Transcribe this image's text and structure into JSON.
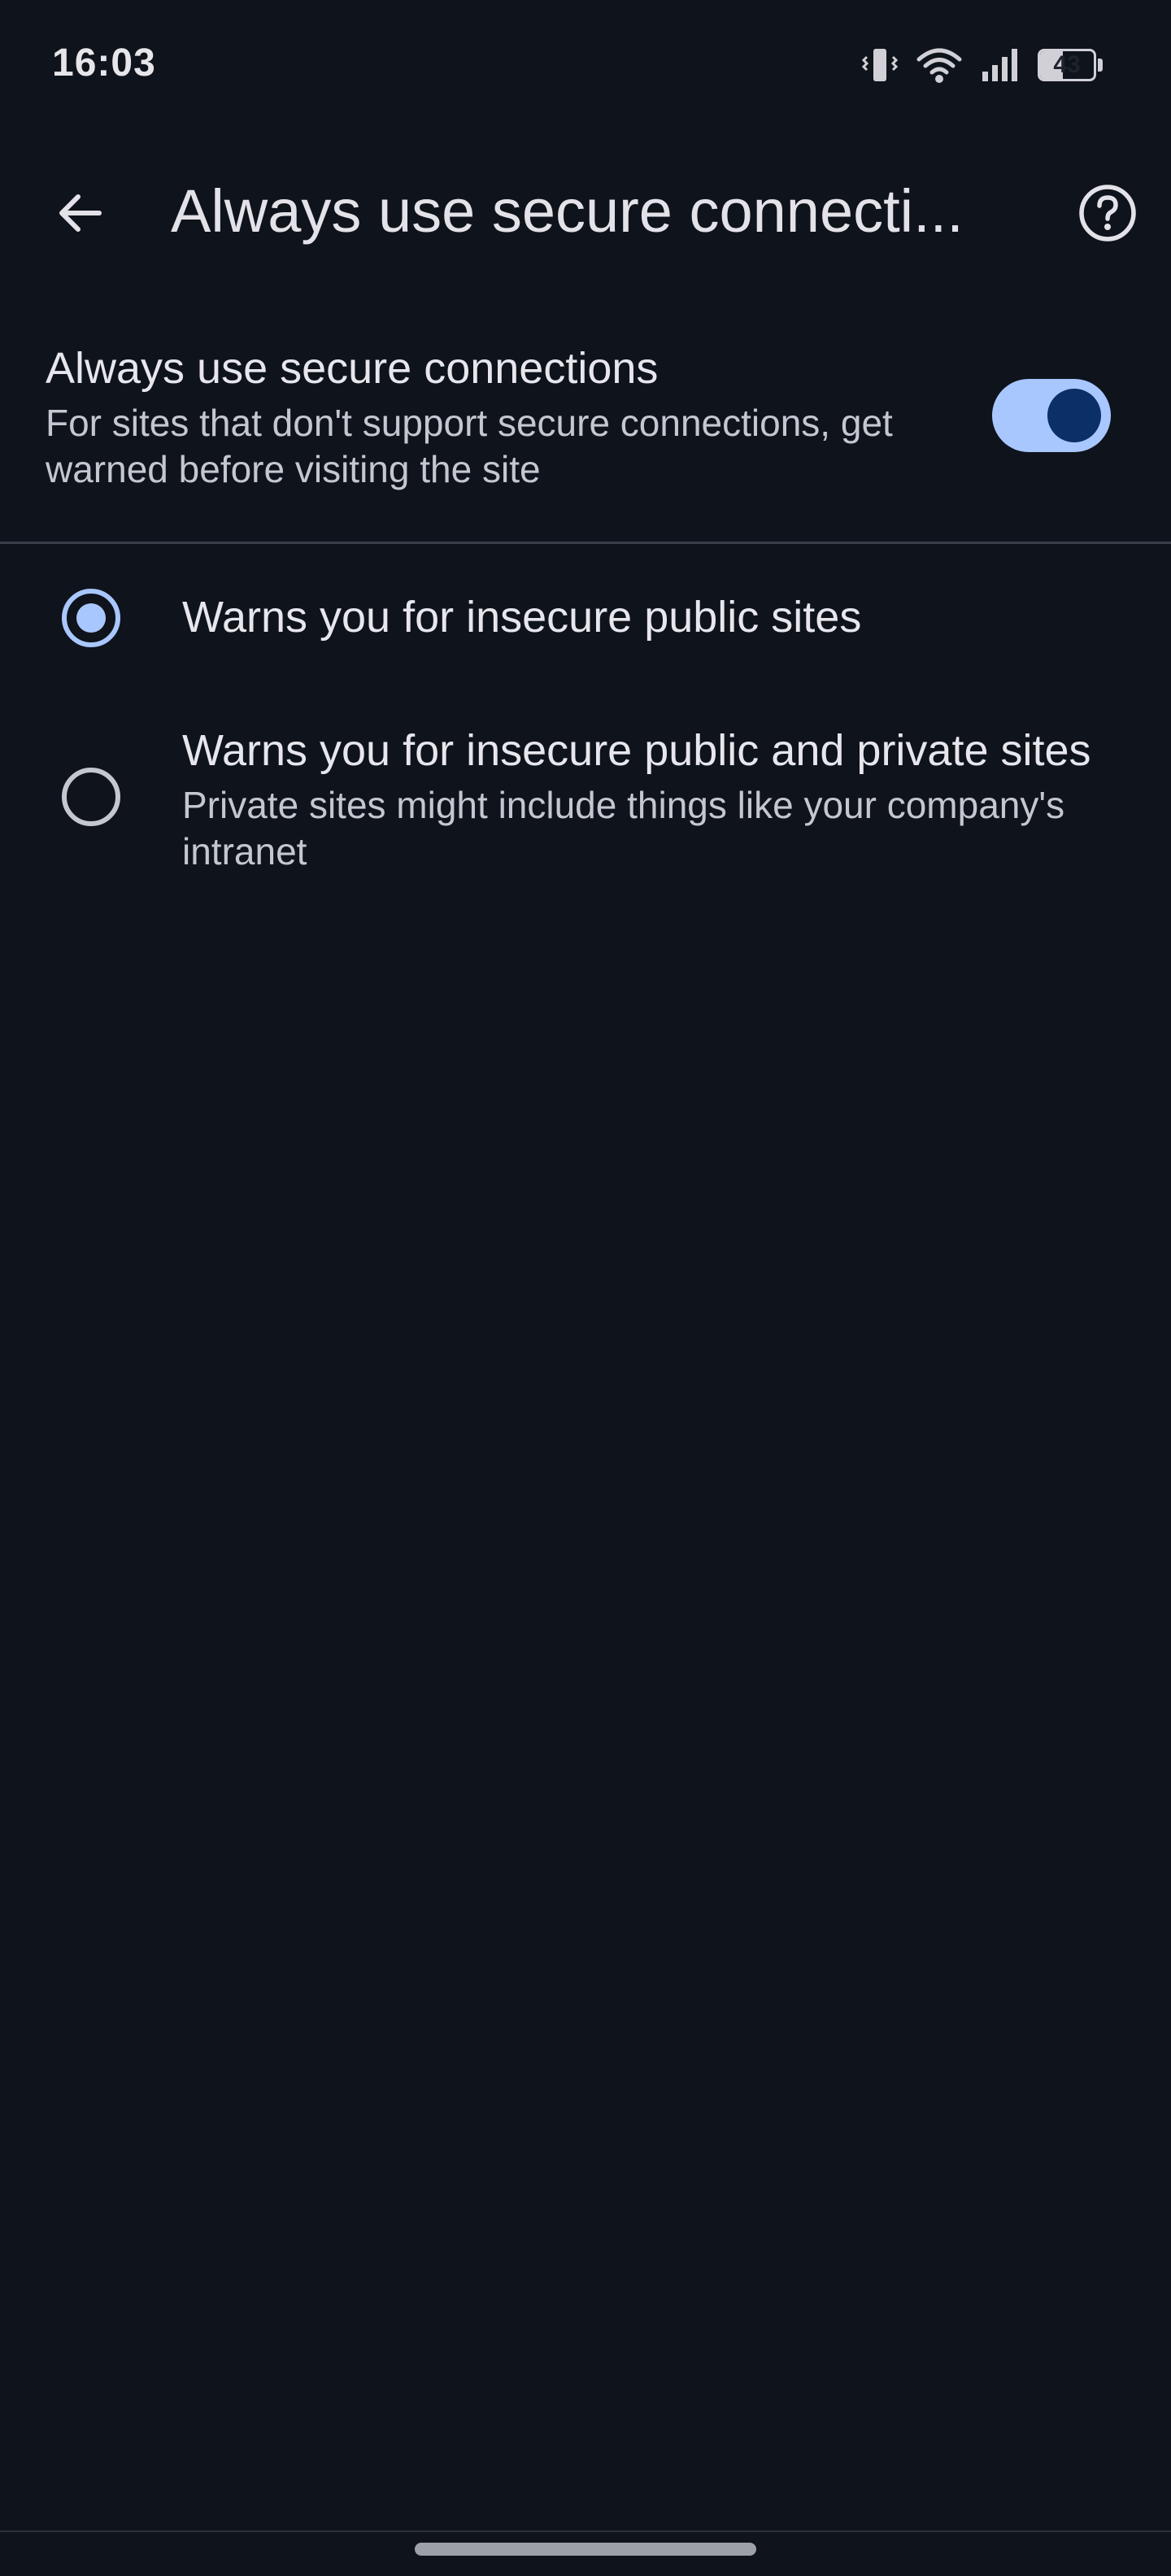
{
  "status_bar": {
    "time": "16:03",
    "battery_percent": "43",
    "battery_level": 0.43,
    "icons": [
      "vibrate-icon",
      "wifi-icon",
      "cellular-signal-icon",
      "battery-icon"
    ]
  },
  "app_bar": {
    "title": "Always use secure connecti...",
    "back_icon": "arrow-back-icon",
    "help_icon": "help-circle-icon"
  },
  "main_toggle": {
    "title": "Always use secure connections",
    "summary": "For sites that don't support secure connections, get warned before visiting the site",
    "checked": true
  },
  "options": [
    {
      "label": "Warns you for insecure public sites",
      "summary": "",
      "selected": true
    },
    {
      "label": "Warns you for insecure public and private sites",
      "summary": "Private sites might include things like your company's intranet",
      "selected": false
    }
  ],
  "colors": {
    "background": "#0f131b",
    "accent": "#a9c7ff",
    "switch_knob": "#0b3068",
    "primary_text": "#e6e6ec",
    "secondary_text": "#c4c6d0"
  }
}
